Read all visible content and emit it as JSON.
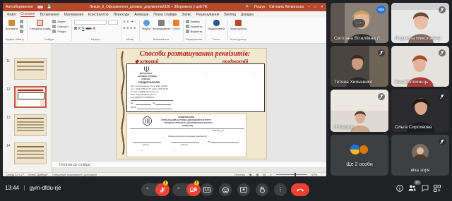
{
  "powerpoint": {
    "titlebar": {
      "autosave": "Автозбереження",
      "doc_title": "Лекція_6_Оформлення_ділових_документів2020 – Збережено у цей ПК",
      "user": "Світлана Литвинська",
      "search": "Пошук"
    },
    "tabs": [
      "Файл",
      "Основне",
      "Вставлення",
      "Малювання",
      "Конструктор",
      "Переходи",
      "Анімація",
      "Показ слайдів",
      "Запис",
      "Рецензування",
      "Вигляд",
      "Довідка"
    ],
    "active_tab": "Основне",
    "ribbon": {
      "paste": "Вставити",
      "layout": "Макет",
      "reset": "Скинути",
      "new_slide": "Створити слайд",
      "section": "Розділ",
      "shapes": "Фігури",
      "arrange": "Упорядкувати",
      "styles": "Стилі",
      "find": "Знайти",
      "replace": "Замінити",
      "select": "Виділити",
      "dictate": "Надиктувати",
      "designer": "Конструктор",
      "groups": [
        "Буфер обміну",
        "Слайди",
        "Шрифт",
        "Абзац",
        "Малювання",
        "Редагування",
        "Голос",
        "Конструктор"
      ]
    },
    "slide_numbers": [
      "11",
      "12",
      "13",
      "14"
    ],
    "slide": {
      "title": "Способи розташування реквізитів:",
      "left_label": "кутовий",
      "right_label": "поздовжній",
      "doc1": {
        "org1": "ДЕРЖАВНА",
        "org2": "АРХІВНА СЛУЖБА",
        "org3": "УКРАЇНИ",
        "org4": "УКРДЕРЖАРХІВ",
        "addr1": "вул. Солом'янська, 24, м. Київ, 03110",
        "addr2": "тел.: (044) 275-27-77, факс: 275-36-36",
        "addr3": "E-mail: mail@archives.gov.ua",
        "addr4": "Web: www.archives.gov.ua",
        "addr5": "Код ЄДРПОУ 37552996",
        "num": "№",
        "na": "На №",
        "vid": "від"
      },
      "doc2": {
        "org1": "УКРДЕРЖАРХІВ",
        "org2": "УКРАЇНСЬКИЙ НАУКОВО-ДОСЛІДНИЙ ІНСТИТУТ",
        "org3": "АРХІВНОЇ СПРАВИ ТА ДОКУМЕНТОЗНАВСТВА",
        "org4": "(УНДІАСД)",
        "date": "Київ 20___р.",
        "kind": "(Назва документа за видом документа)",
        "date_label": "(дата)",
        "place": "(місце)",
        "num": "№"
      }
    },
    "notes": "Нотатки до слайда",
    "status": {
      "slide": "Слайд 12 з 27",
      "lang": "Мова: Дайвуд?",
      "access": "Спеціальні можливості: дослідити",
      "notes": "Нотатки",
      "zoom": "62%"
    }
  },
  "participants": [
    {
      "name": "Світлана Віталіївна Л...",
      "muted": false,
      "has_more": true
    },
    {
      "name": "Людмила Миколаївна",
      "muted": true
    },
    {
      "name": "Тетяна Хильченко",
      "muted": true
    },
    {
      "name": "Інна Коломиєць",
      "muted": true
    },
    {
      "name": "Я Скорик",
      "muted": true
    },
    {
      "name": "Ольга Сирохвова",
      "muted": true
    },
    {
      "name": "Ще 2 особи",
      "muted": false
    },
    {
      "name": "віка зоря",
      "muted": true
    }
  ],
  "meet": {
    "time": "13:44",
    "separator": "|",
    "code": "gym-dfdu-rje",
    "participants_count": "10",
    "alerts": [
      "!",
      "!"
    ]
  },
  "colors": {
    "ppt_red": "#b7472a",
    "meet_bg": "#202124",
    "tile_bg": "#3c4043",
    "hangup_red": "#ea4335",
    "slide_title": "#b0201c"
  }
}
